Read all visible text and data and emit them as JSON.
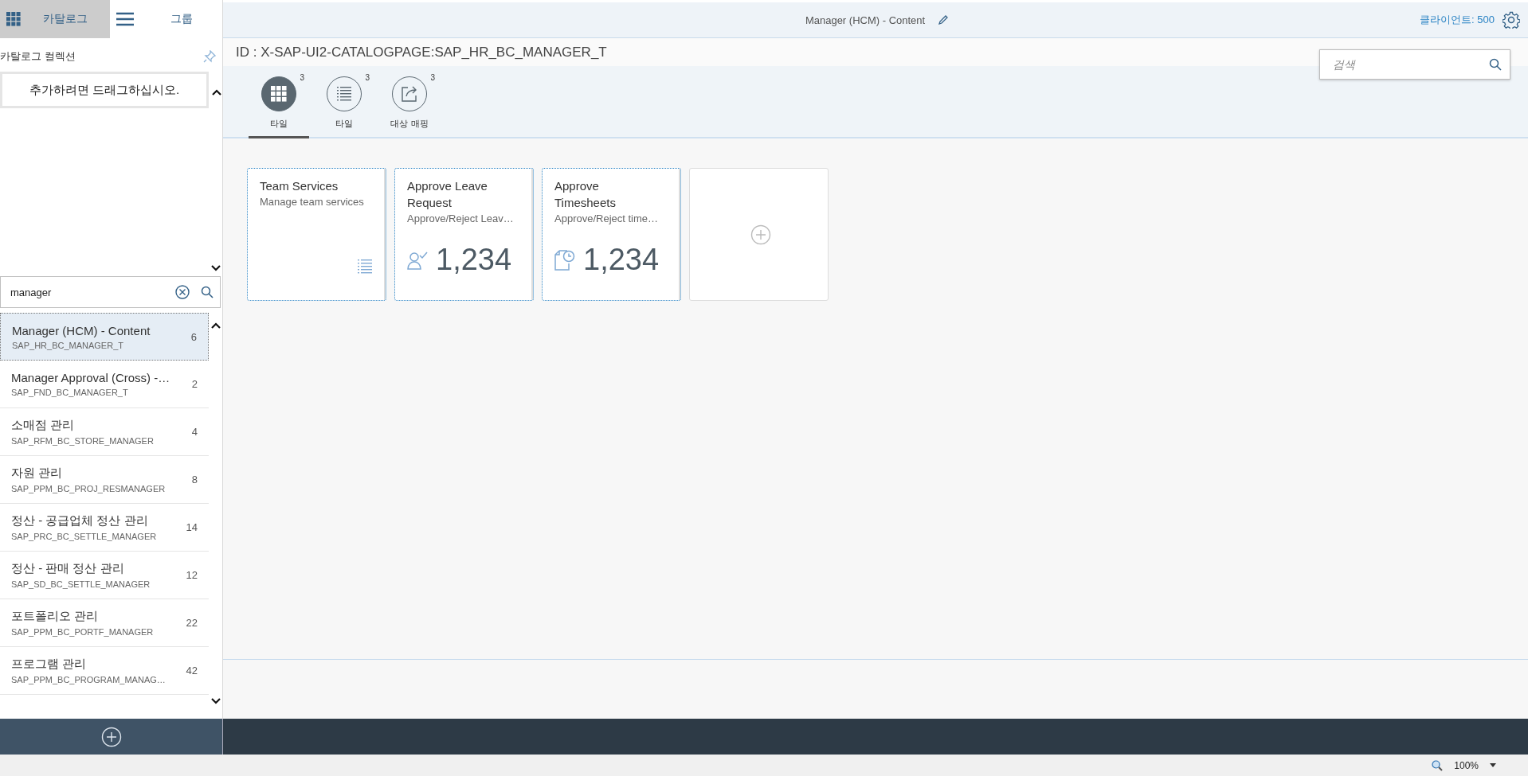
{
  "sidebar": {
    "tabs": [
      {
        "label": "카탈로그",
        "selected": true
      },
      {
        "label": "그룹",
        "selected": false
      }
    ],
    "collection_title": "카탈로그 컬렉션",
    "drop_hint": "추가하려면 드래그하십시오.",
    "search": {
      "value": "manager"
    },
    "catalogs": [
      {
        "title": "Manager (HCM) - Content",
        "id": "SAP_HR_BC_MANAGER_T",
        "count": "6",
        "selected": true
      },
      {
        "title": "Manager Approval (Cross) -…",
        "id": "SAP_FND_BC_MANAGER_T",
        "count": "2",
        "selected": false
      },
      {
        "title": "소매점 관리",
        "id": "SAP_RFM_BC_STORE_MANAGER",
        "count": "4",
        "selected": false
      },
      {
        "title": "자원 관리",
        "id": "SAP_PPM_BC_PROJ_RESMANAGER",
        "count": "8",
        "selected": false
      },
      {
        "title": "정산 - 공급업체 정산 관리",
        "id": "SAP_PRC_BC_SETTLE_MANAGER",
        "count": "14",
        "selected": false
      },
      {
        "title": "정산 - 판매 정산 관리",
        "id": "SAP_SD_BC_SETTLE_MANAGER",
        "count": "12",
        "selected": false
      },
      {
        "title": "포트폴리오 관리",
        "id": "SAP_PPM_BC_PORTF_MANAGER",
        "count": "22",
        "selected": false
      },
      {
        "title": "프로그램 관리",
        "id": "SAP_PPM_BC_PROGRAM_MANAG…",
        "count": "42",
        "selected": false
      }
    ]
  },
  "header": {
    "title": "Manager (HCM) - Content",
    "client": "클라이언트: 500"
  },
  "page_id": "ID : X-SAP-UI2-CATALOGPAGE:SAP_HR_BC_MANAGER_T",
  "search": {
    "placeholder": "검색"
  },
  "icon_tabs": [
    {
      "label": "타일",
      "count": "3",
      "selected": true
    },
    {
      "label": "타일",
      "count": "3",
      "selected": false
    },
    {
      "label": "대상 매핑",
      "count": "3",
      "selected": false
    }
  ],
  "tiles": [
    {
      "kind": "static",
      "title": "Team Services",
      "subtitle": "Manage team services"
    },
    {
      "kind": "numeric",
      "title": "Approve Leave Request",
      "subtitle": "Approve/Reject Leav…",
      "number": "1,234"
    },
    {
      "kind": "numeric",
      "title": "Approve Timesheets",
      "subtitle": "Approve/Reject time…",
      "number": "1,234"
    },
    {
      "kind": "add"
    }
  ],
  "status_bar": {
    "zoom": "100%"
  }
}
